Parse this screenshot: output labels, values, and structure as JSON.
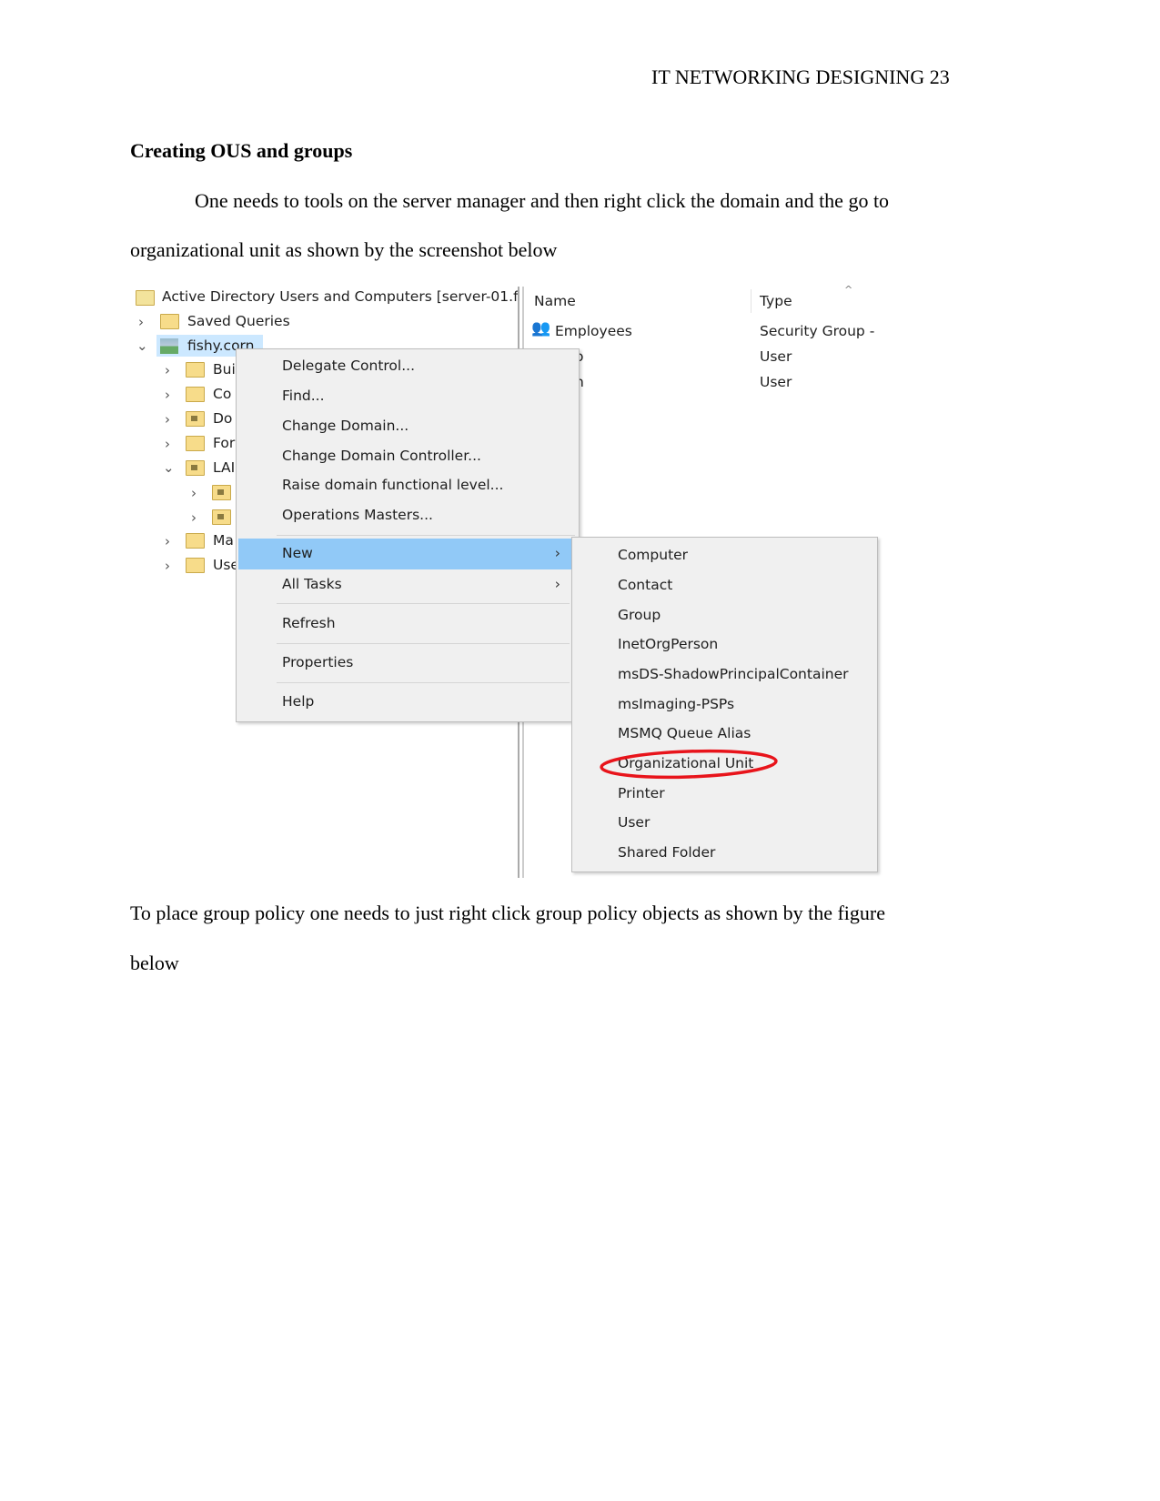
{
  "header": {
    "running_head": "IT NETWORKING DESIGNING 23"
  },
  "section": {
    "heading": "Creating OUS and groups"
  },
  "paragraphs": [
    "One needs to tools on the server manager and then right click the domain and the go to",
    "organizational unit as shown by the screenshot below",
    "To place group policy one needs to just right click group policy objects as shown by the figure",
    "below"
  ],
  "screenshot": {
    "tree": {
      "root": "Active Directory Users and Computers [server-01.f",
      "saved_queries": "Saved Queries",
      "domain": "fishy.corn",
      "children": [
        "Bui",
        "Co",
        "Do",
        "For",
        "LAI",
        "",
        "",
        "Ma",
        "Use"
      ]
    },
    "list": {
      "columns": [
        "Name",
        "Type"
      ],
      "rows": [
        {
          "name": "Employees",
          "type": "Security Group -"
        },
        {
          "name": "o",
          "type": "User"
        },
        {
          "name": "n",
          "type": "User"
        }
      ]
    },
    "context_menu": {
      "items": [
        "Delegate Control...",
        "Find...",
        "Change Domain...",
        "Change Domain Controller...",
        "Raise domain functional level...",
        "Operations Masters...",
        "New",
        "All Tasks",
        "Refresh",
        "Properties",
        "Help"
      ],
      "highlighted": "New"
    },
    "submenu": {
      "items": [
        "Computer",
        "Contact",
        "Group",
        "InetOrgPerson",
        "msDS-ShadowPrincipalContainer",
        "msImaging-PSPs",
        "MSMQ Queue Alias",
        "Organizational Unit",
        "Printer",
        "User",
        "Shared Folder"
      ],
      "circled": "Organizational Unit",
      "circle_color": "#e8141b"
    },
    "highlight_color": "#91c9f7"
  }
}
